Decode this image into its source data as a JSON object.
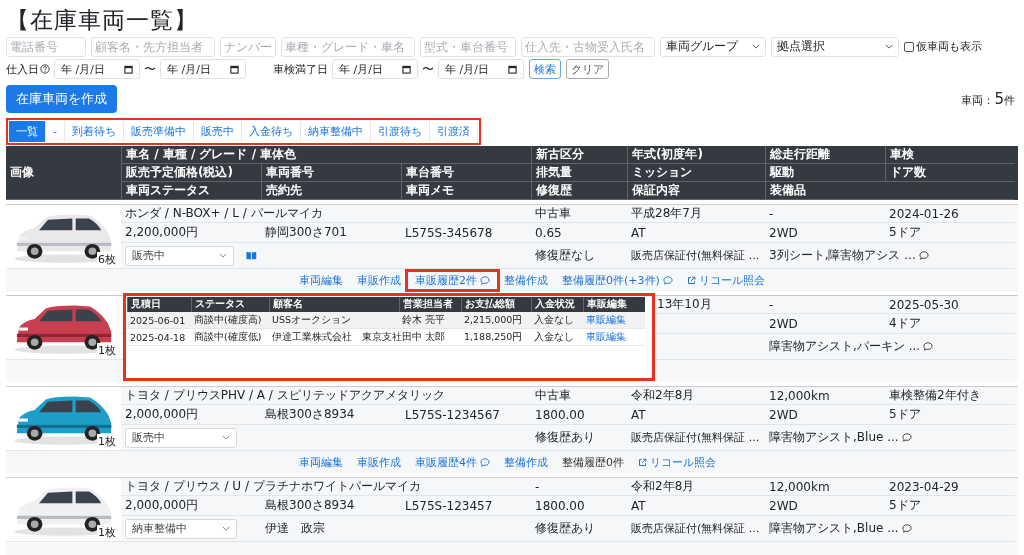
{
  "title": "【在庫車両一覧】",
  "filters": {
    "text_fields": [
      {
        "placeholder": "電話番号"
      },
      {
        "placeholder": "顧客名・先方担当者"
      },
      {
        "placeholder": "ナンバー"
      },
      {
        "placeholder": "車種・グレード・車名"
      },
      {
        "placeholder": "型式・車台番号"
      },
      {
        "placeholder": "仕入先・古物受入氏名"
      }
    ],
    "selects": [
      {
        "value": "車両グループ"
      },
      {
        "value": "拠点選択"
      }
    ],
    "checkbox": {
      "label": "仮車両も表示",
      "checked": false
    },
    "date_ranges": [
      {
        "label": "仕入日",
        "help": true,
        "from": "年 /月/日",
        "to": "年 /月/日",
        "separator": "〜"
      },
      {
        "label": "車検満了日",
        "help": false,
        "from": "年 /月/日",
        "to": "年 /月/日",
        "separator": "〜"
      }
    ],
    "search_button": "検索",
    "clear_button": "クリア"
  },
  "create_button": "在庫車両を作成",
  "count": {
    "label": "車両：",
    "value": "5",
    "unit": "件"
  },
  "tabs": {
    "highlighted": true,
    "items": [
      {
        "label": "一覧",
        "selected": true
      },
      {
        "label": "-",
        "selected": false
      },
      {
        "label": "到着待ち",
        "selected": false
      },
      {
        "label": "販売準備中",
        "selected": false
      },
      {
        "label": "販売中",
        "selected": false
      },
      {
        "label": "入金待ち",
        "selected": false
      },
      {
        "label": "納車整備中",
        "selected": false
      },
      {
        "label": "引渡待ち",
        "selected": false
      },
      {
        "label": "引渡済",
        "selected": false
      }
    ]
  },
  "table": {
    "header": {
      "image": "画像",
      "name": "車名 / 車種 / グレード / 車体色",
      "category": "新古区分",
      "year": "年式(初度年)",
      "mileage": "総走行距離",
      "inspection": "車検",
      "price": "販売予定価格(税込)",
      "plate": "車両番号",
      "chassis": "車台番号",
      "displacement": "排気量",
      "transmission": "ミッション",
      "drive": "駆動",
      "doors": "ドア数",
      "status": "車両ステータス",
      "buyer": "売約先",
      "memo": "車両メモ",
      "repair": "修復歴",
      "warranty": "保証内容",
      "equipment": "装備品"
    },
    "rows": [
      {
        "photo": {
          "kind": "picture"
        },
        "photo_count": "6枚",
        "name": "ホンダ / N-BOX+ / L / パールマイカ",
        "category": "中古車",
        "year": "平成28年7月",
        "mileage": "-",
        "inspection": "2024-01-26",
        "price": "2,200,000円",
        "plate": "静岡300さ701",
        "chassis": "L575S-345678",
        "displacement": "0.65",
        "transmission": "AT",
        "drive": "2WD",
        "doors": "5ドア",
        "status": "販売中",
        "manual": true,
        "repair": "修復歴なし",
        "warranty": "販売店保証付(無料保証 ...",
        "equipment": "3列シート,障害物アシス ...",
        "comment": true,
        "links": [
          {
            "text": "車両編集",
            "kind": "link"
          },
          {
            "text": "車販作成",
            "kind": "link"
          },
          {
            "text": "車販履歴2件",
            "kind": "link",
            "comment": true,
            "highlighted": true
          },
          {
            "text": "整備作成",
            "kind": "link"
          },
          {
            "text": "整備履歴0件(+3件)",
            "kind": "link",
            "comment": true
          },
          {
            "text": "リコール照会",
            "kind": "external"
          }
        ]
      },
      {
        "photo": {
          "kind": "picture"
        },
        "photo_count": "1枚",
        "year": "13年10月",
        "mileage": "-",
        "inspection": "2025-05-30",
        "drive": "2WD",
        "doors": "4ドア",
        "equipment": "障害物アシスト,パーキン ...",
        "comment": true,
        "popup": {
          "highlighted": true,
          "columns": [
            "見積日",
            "ステータス",
            "顧客名",
            "営業担当者",
            "お支払総額",
            "入金状況",
            "車販編集"
          ],
          "rows": [
            [
              "2025-06-01",
              "商談中(確度高)",
              "USSオークション",
              "鈴木 亮平",
              "2,215,000円",
              "入金なし",
              "車販編集"
            ],
            [
              "2025-04-18",
              "商談中(確度低)",
              "伊達工業株式会社　東京支社",
              "田中 太郎",
              "1,188,250円",
              "入金なし",
              "車販編集"
            ]
          ]
        }
      },
      {
        "photo": {
          "kind": "picture"
        },
        "photo_count": "1枚",
        "name": "トヨタ / プリウスPHV / A / スピリテッドアクアメタリック",
        "category": "中古車",
        "year": "令和2年8月",
        "mileage": "12,000km",
        "inspection": "車検整備2年付き",
        "price": "2,000,000円",
        "plate": "島根300さ8934",
        "chassis": "L575S-1234567",
        "displacement": "1800.00",
        "transmission": "AT",
        "drive": "2WD",
        "doors": "5ドア",
        "status": "販売中",
        "repair": "修復歴あり",
        "warranty": "販売店保証付(無料保証 ...",
        "equipment": "障害物アシスト,Blue ...",
        "comment": true,
        "links": [
          {
            "text": "車両編集",
            "kind": "link"
          },
          {
            "text": "車販作成",
            "kind": "link"
          },
          {
            "text": "車販履歴4件",
            "kind": "link",
            "comment": true
          },
          {
            "text": "整備作成",
            "kind": "link"
          },
          {
            "text": "整備履歴0件",
            "kind": "plain"
          },
          {
            "text": "リコール照会",
            "kind": "external"
          }
        ]
      },
      {
        "photo": {
          "kind": "picture"
        },
        "photo_count": "1枚",
        "name": "トヨタ / プリウス / U / プラチナホワイトパールマイカ",
        "category": "-",
        "year": "令和2年8月",
        "mileage": "12,000km",
        "inspection": "2023-04-29",
        "price": "2,000,000円",
        "plate": "島根300さ8934",
        "chassis": "L575S-123457",
        "displacement": "1800.00",
        "transmission": "AT",
        "drive": "2WD",
        "doors": "5ドア",
        "status": "納車整備中",
        "buyer": "伊達　政宗",
        "repair": "修復歴あり",
        "warranty": "販売店保証付(無料保証 ...",
        "equipment": "障害物アシスト,Blue ...",
        "comment": true
      }
    ]
  }
}
